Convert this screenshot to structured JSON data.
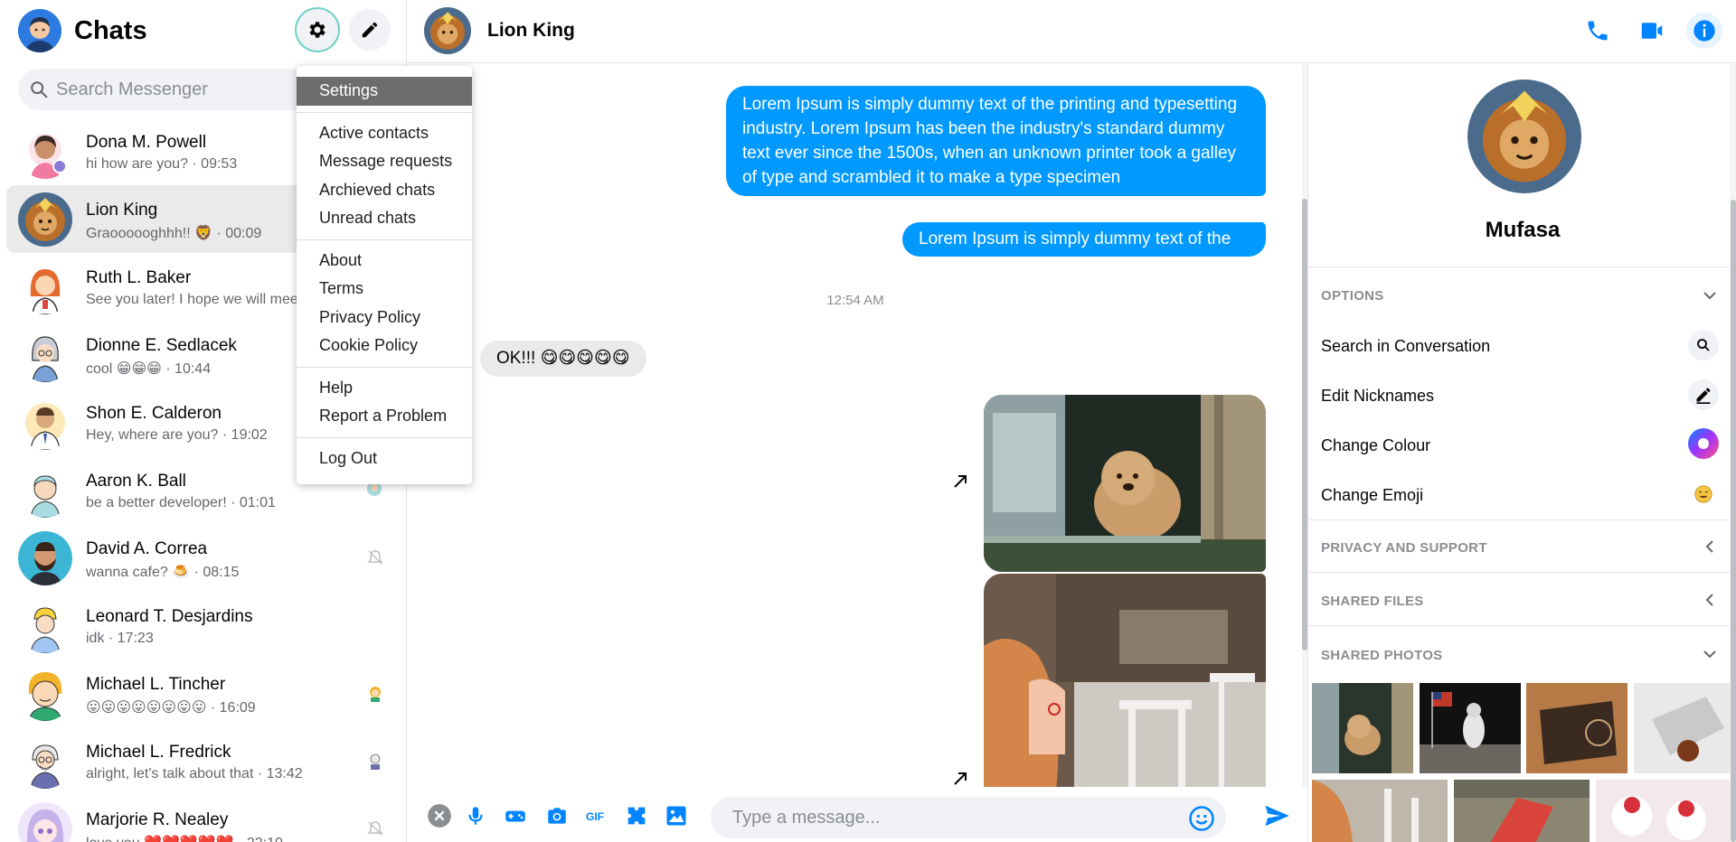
{
  "sidebar": {
    "title": "Chats",
    "search_placeholder": "Search Messenger",
    "chats": [
      {
        "name": "Dona M. Powell",
        "preview": "hi how are you? · 09:53",
        "active": false
      },
      {
        "name": "Lion King",
        "preview": "Graoooooghhh!! 🦁 · 00:09",
        "active": true
      },
      {
        "name": "Ruth L. Baker",
        "preview": "See you later! I hope we will meet",
        "active": false
      },
      {
        "name": "Dionne E. Sedlacek",
        "preview": "cool 😁😁😁 · 10:44",
        "active": false
      },
      {
        "name": "Shon E. Calderon",
        "preview": "Hey, where are you? · 19:02",
        "active": false
      },
      {
        "name": "Aaron K. Ball",
        "preview": "be a better developer! · 01:01",
        "active": false
      },
      {
        "name": "David A. Correa",
        "preview": "wanna cafe? 🍮 · 08:15",
        "active": false
      },
      {
        "name": "Leonard T. Desjardins",
        "preview": "idk · 17:23",
        "active": false
      },
      {
        "name": "Michael L. Tincher",
        "preview": "😛😛😛😛😛😛😛😛 · 16:09",
        "active": false
      },
      {
        "name": "Michael L. Fredrick",
        "preview": "alright, let's talk about that · 13:42",
        "active": false
      },
      {
        "name": "Marjorie R. Nealey",
        "preview": "love you ❤️❤️❤️❤️❤️ · 22:10",
        "active": false
      }
    ]
  },
  "settings_menu": {
    "groups": [
      [
        "Settings"
      ],
      [
        "Active contacts",
        "Message requests",
        "Archieved chats",
        "Unread chats"
      ],
      [
        "About",
        "Terms",
        "Privacy Policy",
        "Cookie Policy"
      ],
      [
        "Help",
        "Report a Problem"
      ],
      [
        "Log Out"
      ]
    ]
  },
  "conversation": {
    "title": "Lion King",
    "messages": {
      "outgoing_1": "Lorem Ipsum is simply dummy text of the printing and typesetting industry. Lorem Ipsum has been the industry's standard dummy text ever since the 1500s, when an unknown printer took a galley of type and scrambled it to make a type specimen",
      "outgoing_2": "Lorem Ipsum is simply dummy text of the",
      "timestamp": "12:54 AM",
      "incoming_1": "OK!!! 😋😋😋😋😋"
    },
    "composer_placeholder": "Type a message..."
  },
  "details": {
    "name": "Mufasa",
    "sections": {
      "options": "OPTIONS",
      "privacy": "PRIVACY AND SUPPORT",
      "files": "SHARED FILES",
      "photos": "SHARED PHOTOS"
    },
    "options": [
      "Search in Conversation",
      "Edit Nicknames",
      "Change Colour",
      "Change Emoji"
    ]
  },
  "colors": {
    "accent": "#0084ff",
    "outgoing_bubble": "#0099ff",
    "incoming_bubble": "#eaeaea",
    "active_chat": "#eaeaea",
    "menu_highlight": "#6d6d6d"
  },
  "icons": [
    "search-icon",
    "gear-icon",
    "pencil-icon",
    "phone-icon",
    "video-icon",
    "info-icon",
    "close-circle-icon",
    "microphone-icon",
    "gamepad-icon",
    "camera-icon",
    "gif-icon",
    "sticker-icon",
    "image-icon",
    "emoji-icon",
    "send-icon",
    "expand-arrow-icon",
    "chevron-down-icon",
    "chevron-left-icon",
    "muted-icon"
  ]
}
